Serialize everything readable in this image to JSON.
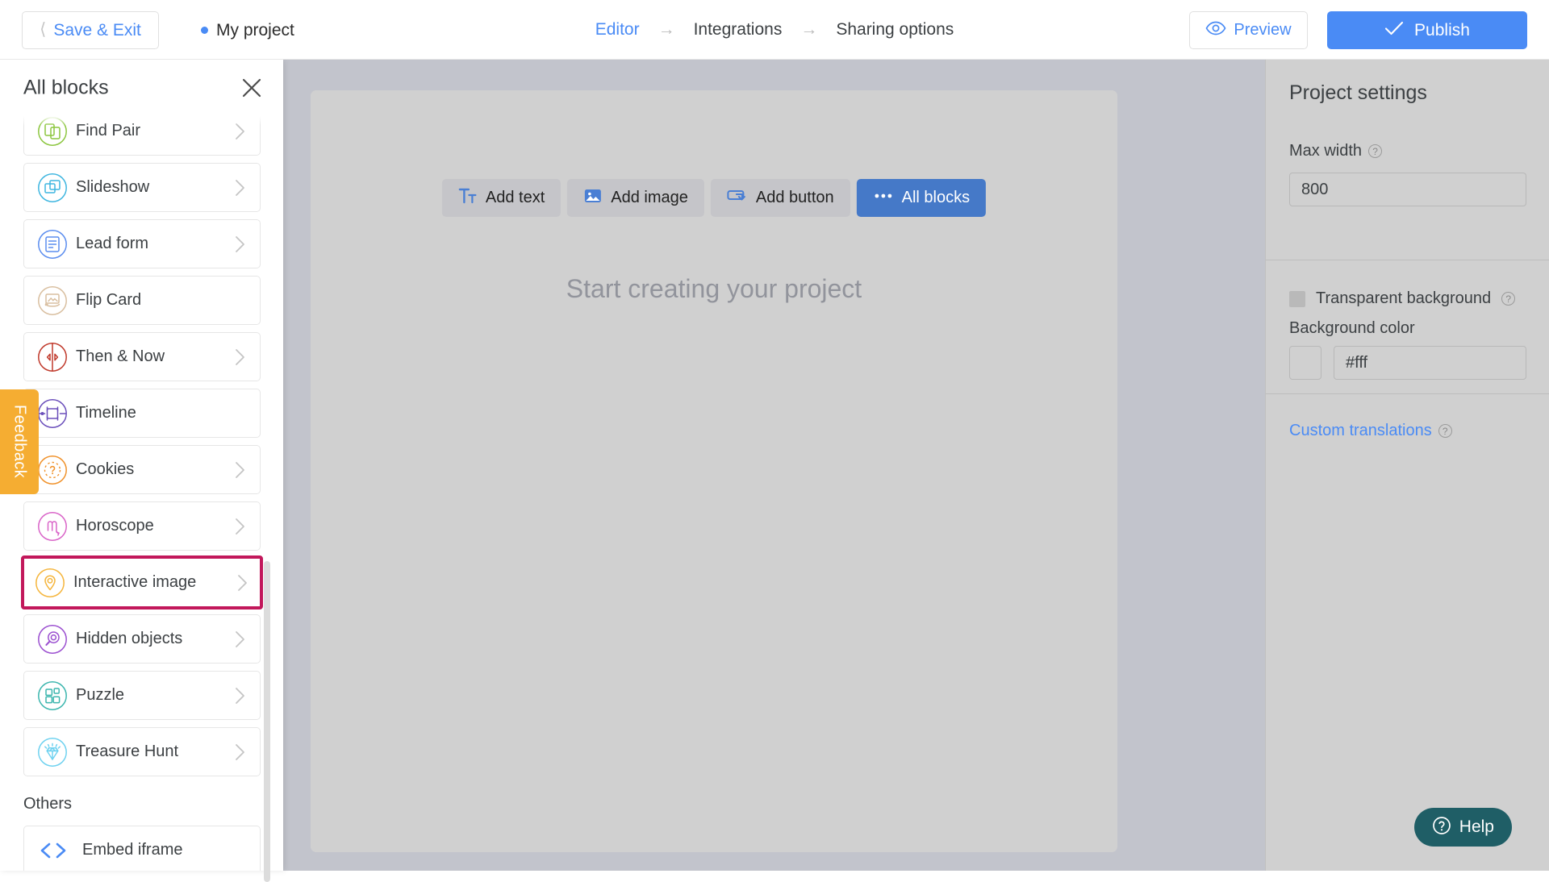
{
  "topbar": {
    "save_exit_label": "Save & Exit",
    "back_chevron_icon": "chevron-left-icon",
    "project_status_icon": "status-dot-icon",
    "project_name": "My project",
    "breadcrumb": [
      {
        "label": "Editor",
        "active": true
      },
      {
        "label": "Integrations",
        "active": false
      },
      {
        "label": "Sharing options",
        "active": false
      }
    ],
    "breadcrumb_arrow": "→",
    "preview_label": "Preview",
    "preview_icon": "eye-icon",
    "publish_label": "Publish",
    "publish_icon": "check-icon",
    "accent_color": "#4a8bf5"
  },
  "sidebar": {
    "title": "All blocks",
    "close_icon": "close-icon",
    "chevron_icon": "chevron-right-icon",
    "others_heading": "Others",
    "scrollbar_name": "sidebar-scrollbar",
    "highlight_color": "#c2185b",
    "blocks": [
      {
        "label": "Find Pair",
        "icon": "find-pair-icon",
        "color": "#8cc63f",
        "selected": false,
        "has_chevron": true,
        "partial": true
      },
      {
        "label": "Slideshow",
        "icon": "slideshow-icon",
        "color": "#3fb6e0",
        "selected": false,
        "has_chevron": true
      },
      {
        "label": "Lead form",
        "icon": "lead-form-icon",
        "color": "#5b8def",
        "selected": false,
        "has_chevron": true
      },
      {
        "label": "Flip Card",
        "icon": "flip-card-icon",
        "color": "#d9bfa0",
        "selected": false,
        "has_chevron": false
      },
      {
        "label": "Then & Now",
        "icon": "then-and-now-icon",
        "color": "#c0392b",
        "selected": false,
        "has_chevron": true
      },
      {
        "label": "Timeline",
        "icon": "timeline-icon",
        "color": "#6b4fbb",
        "selected": false,
        "has_chevron": false
      },
      {
        "label": "Cookies",
        "icon": "cookies-icon",
        "color": "#f0922b",
        "selected": false,
        "has_chevron": true
      },
      {
        "label": "Horoscope",
        "icon": "horoscope-icon",
        "color": "#d964c8",
        "selected": false,
        "has_chevron": true
      },
      {
        "label": "Interactive image",
        "icon": "interactive-image-icon",
        "color": "#f5b53c",
        "selected": true,
        "has_chevron": true
      },
      {
        "label": "Hidden objects",
        "icon": "hidden-objects-icon",
        "color": "#9b4fd0",
        "selected": false,
        "has_chevron": true
      },
      {
        "label": "Puzzle",
        "icon": "puzzle-icon",
        "color": "#3cb6ae",
        "selected": false,
        "has_chevron": true
      },
      {
        "label": "Treasure Hunt",
        "icon": "treasure-hunt-icon",
        "color": "#6fd2f0",
        "selected": false,
        "has_chevron": true
      }
    ],
    "others": [
      {
        "label": "Embed iframe",
        "icon": "embed-code-icon",
        "color": "#4a8bf5"
      }
    ]
  },
  "feedback": {
    "label": "Feedback",
    "color": "#f5ad32"
  },
  "canvas": {
    "placeholder": "Start creating your project",
    "toolbar": [
      {
        "label": "Add text",
        "icon": "text-format-icon",
        "primary": false
      },
      {
        "label": "Add image",
        "icon": "image-icon",
        "primary": false
      },
      {
        "label": "Add button",
        "icon": "button-icon",
        "primary": false
      },
      {
        "label": "All blocks",
        "icon": "ellipsis-icon",
        "primary": true
      }
    ]
  },
  "right_panel": {
    "title": "Project settings",
    "max_width_label": "Max width",
    "max_width_value": "800",
    "max_width_help_icon": "help-circle-icon",
    "transparent_bg_label": "Transparent background",
    "transparent_bg_checked": false,
    "transparent_bg_help_icon": "help-circle-icon",
    "background_color_label": "Background color",
    "background_color_value": "#fff",
    "background_swatch_name": "background-color-swatch",
    "custom_translations_label": "Custom translations",
    "custom_translations_help_icon": "help-circle-icon"
  },
  "help_widget": {
    "label": "Help",
    "icon": "help-circle-icon",
    "color": "#1f5e66"
  }
}
